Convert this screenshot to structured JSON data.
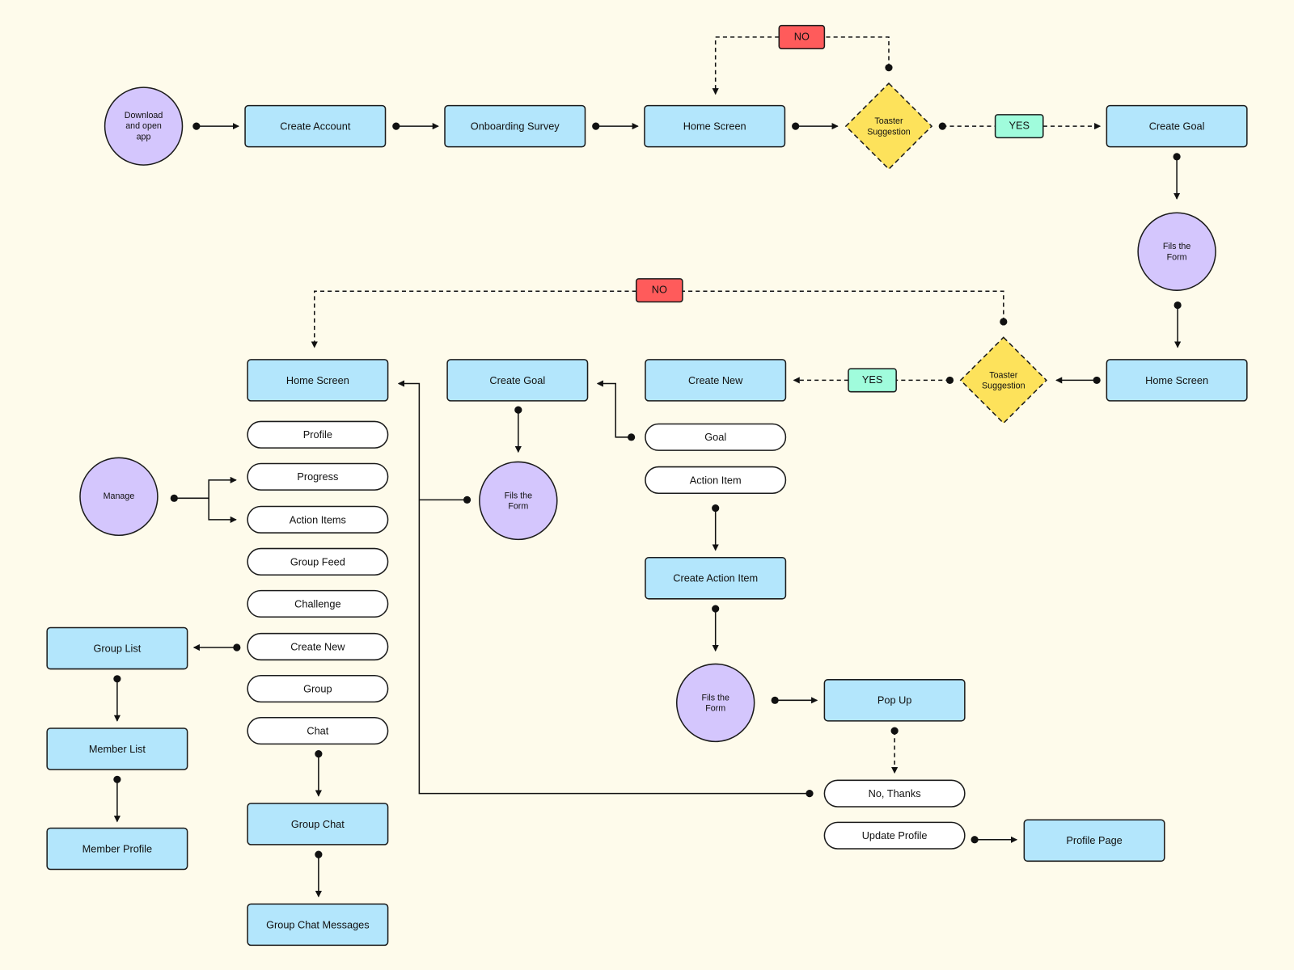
{
  "nodes": {
    "download": [
      "Download",
      "and open",
      "app"
    ],
    "create_account": "Create Account",
    "onboarding_survey": "Onboarding Survey",
    "home_screen_1": "Home Screen",
    "toaster_1": [
      "Toaster",
      "Suggestion"
    ],
    "no_1": "NO",
    "yes_1": "YES",
    "create_goal_1": "Create Goal",
    "fils_form_1": [
      "Fils the",
      "Form"
    ],
    "home_screen_2": "Home Screen",
    "toaster_2": [
      "Toaster",
      "Suggestion"
    ],
    "no_2": "NO",
    "yes_2": "YES",
    "create_new_1": "Create New",
    "goal": "Goal",
    "action_item": "Action Item",
    "create_goal_2": "Create Goal",
    "fils_form_2": [
      "Fils the",
      "Form"
    ],
    "home_screen_3": "Home Screen",
    "create_action_item": "Create Action Item",
    "fils_form_3": [
      "Fils the",
      "Form"
    ],
    "pop_up": "Pop Up",
    "no_thanks": "No, Thanks",
    "update_profile": "Update Profile",
    "profile_page": "Profile Page",
    "manage": "Manage",
    "menu": [
      "Profile",
      "Progress",
      "Action Items",
      "Group Feed",
      "Challenge",
      "Create New",
      "Group",
      "Chat"
    ],
    "group_list": "Group List",
    "member_list": "Member List",
    "member_profile": "Member Profile",
    "group_chat": "Group Chat",
    "group_chat_messages": "Group Chat Messages"
  },
  "colors": {
    "background": "#fefbeb",
    "screen": "#b3e6fc",
    "action": "#d4c6fd",
    "decision": "#fde25b",
    "no": "#ff5b5b",
    "yes": "#a0fcdc",
    "option": "#ffffff"
  }
}
